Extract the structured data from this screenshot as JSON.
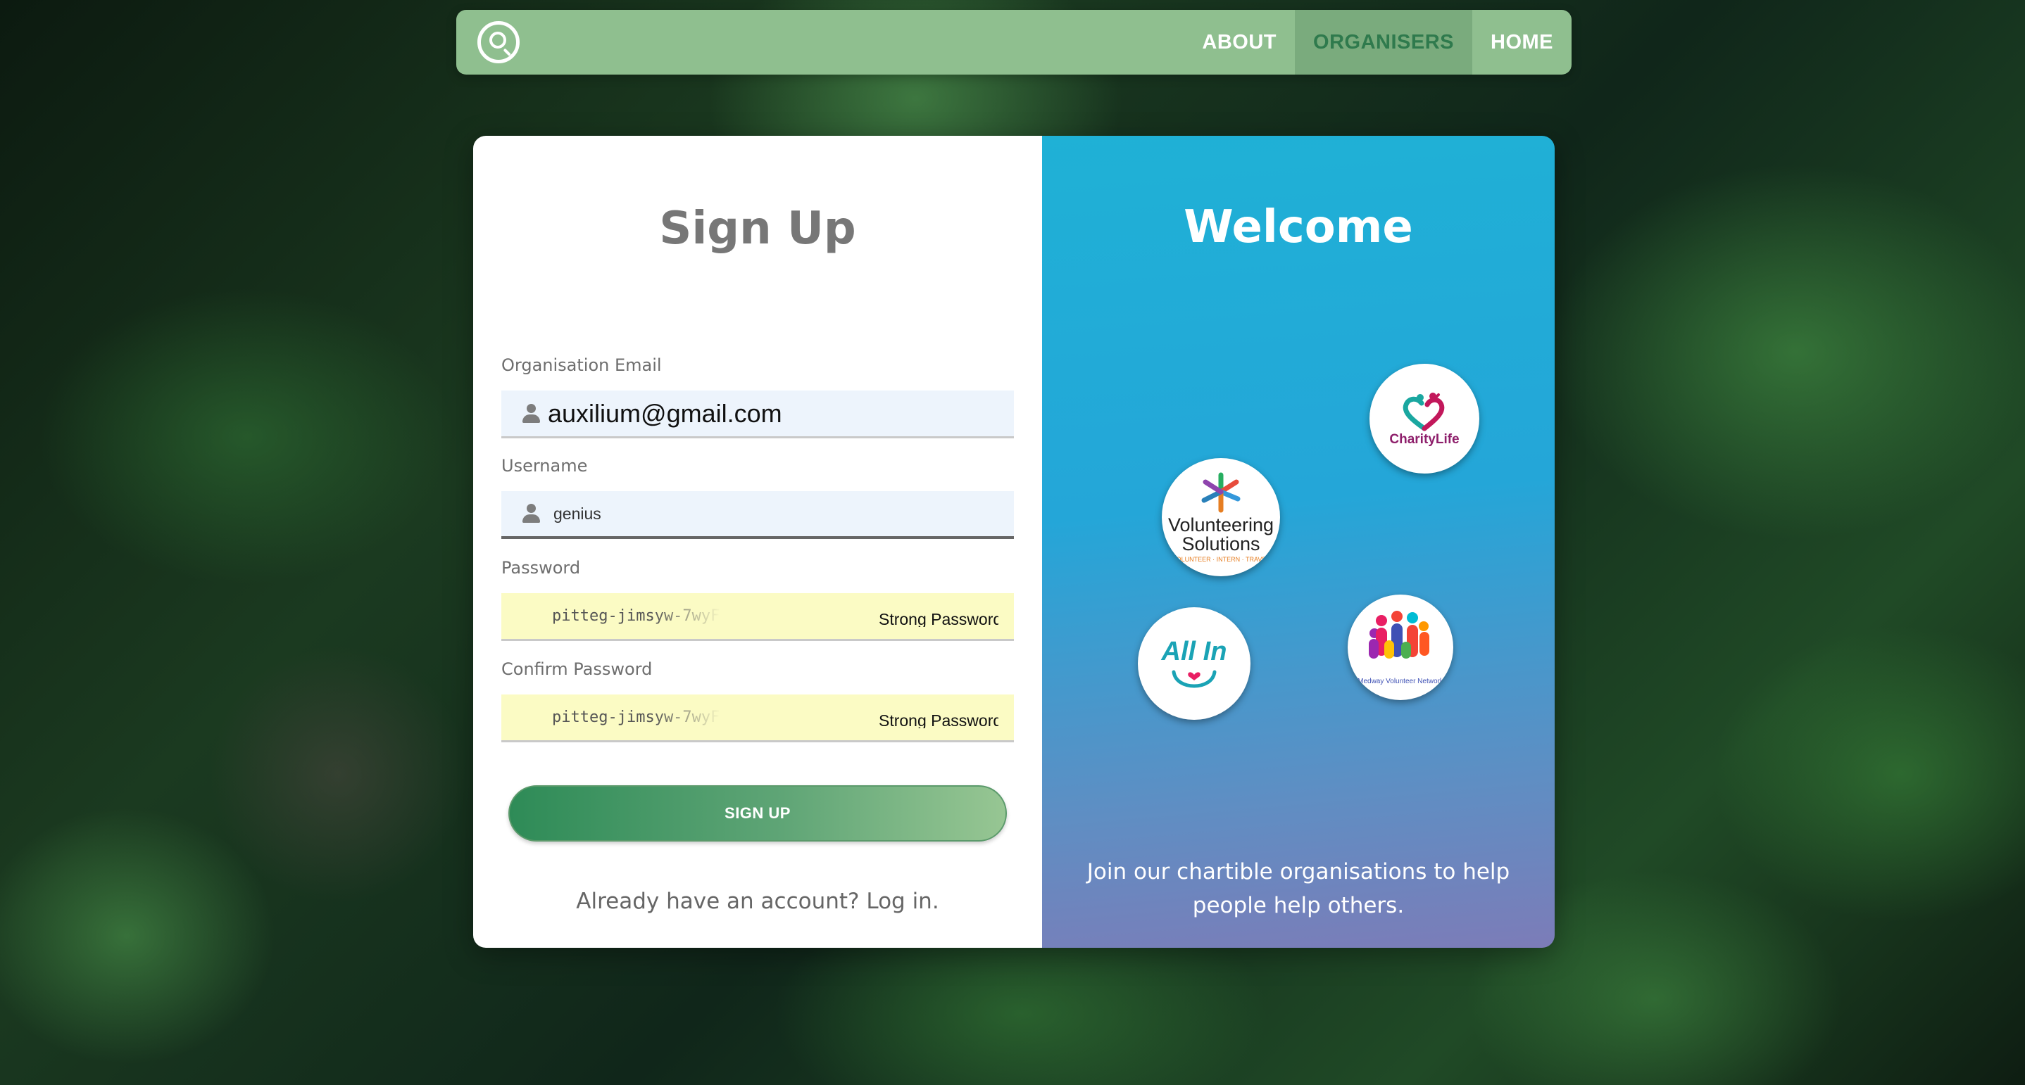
{
  "nav": {
    "items": [
      {
        "label": "ABOUT",
        "active": false
      },
      {
        "label": "ORGANISERS",
        "active": true
      },
      {
        "label": "HOME",
        "active": false
      }
    ],
    "icons": {
      "search": "search-icon"
    },
    "colors": {
      "navbar_bg": "#8fbf8f",
      "active_text": "#2f7a4d",
      "active_bg": "#7aab7d"
    }
  },
  "form": {
    "title": "Sign Up",
    "email": {
      "label": "Organisation Email",
      "value": "auxilium@gmail.com",
      "icon": "user-icon"
    },
    "username": {
      "label": "Username",
      "value": "genius",
      "icon": "user-icon"
    },
    "password": {
      "label": "Password",
      "value": "pitteg-jimsyw-7wyF",
      "hint": "Strong Password"
    },
    "confirm_password": {
      "label": "Confirm Password",
      "value": "pitteg-jimsyw-7wyF",
      "hint": "Strong Password"
    },
    "submit_label": "SIGN UP",
    "login_prompt": "Already have an account? Log in."
  },
  "welcome": {
    "title": "Welcome",
    "logos": [
      {
        "name": "CharityLife",
        "text": "CharityLife"
      },
      {
        "name": "Volunteering Solutions",
        "line1": "Volunteering",
        "line2": "Solutions",
        "sub": "VOLUNTEER · INTERN · TRAVEL"
      },
      {
        "name": "All In",
        "text": "All In"
      },
      {
        "name": "Medway Volunteer Network",
        "text": "Medway Volunteer Network"
      }
    ],
    "tagline_line1": "Join our chartible organisations to help",
    "tagline_line2": "people help others.",
    "colors": {
      "gradient_top": "#1fb1d6",
      "gradient_bottom": "#7c7cb8"
    }
  }
}
